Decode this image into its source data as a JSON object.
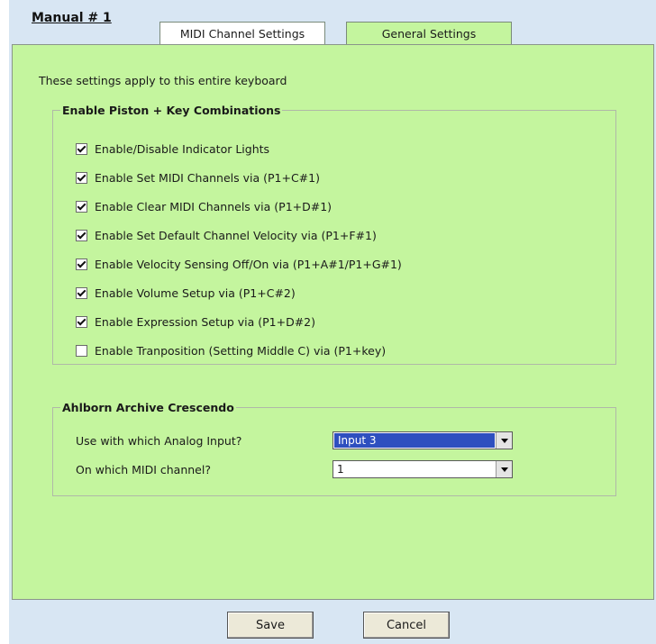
{
  "header": {
    "title": "Manual # 1"
  },
  "tabs": [
    {
      "label": "MIDI Channel Settings",
      "active": false
    },
    {
      "label": "General Settings",
      "active": true
    }
  ],
  "panel": {
    "intro": "These settings apply to this entire keyboard",
    "piston_group": {
      "legend": "Enable Piston + Key Combinations",
      "items": [
        {
          "label": "Enable/Disable Indicator Lights",
          "checked": true
        },
        {
          "label": "Enable Set MIDI Channels via (P1+C#1)",
          "checked": true
        },
        {
          "label": "Enable Clear MIDI Channels via (P1+D#1)",
          "checked": true
        },
        {
          "label": "Enable Set Default Channel Velocity via (P1+F#1)",
          "checked": true
        },
        {
          "label": "Enable Velocity Sensing Off/On via (P1+A#1/P1+G#1)",
          "checked": true
        },
        {
          "label": "Enable Volume Setup via (P1+C#2)",
          "checked": true
        },
        {
          "label": "Enable Expression Setup via (P1+D#2)",
          "checked": true
        },
        {
          "label": "Enable Tranposition (Setting Middle C) via (P1+key)",
          "checked": false
        }
      ]
    },
    "crescendo_group": {
      "legend": "Ahlborn Archive Crescendo",
      "analog_input_label": "Use with which Analog Input?",
      "analog_input_value": "Input 3",
      "midi_channel_label": "On which MIDI channel?",
      "midi_channel_value": "1"
    }
  },
  "buttons": {
    "save_label": "Save",
    "cancel_label": "Cancel"
  },
  "colors": {
    "panel": "#c4f59e",
    "window": "#d8e6f3",
    "selection": "#2e4fbf"
  }
}
